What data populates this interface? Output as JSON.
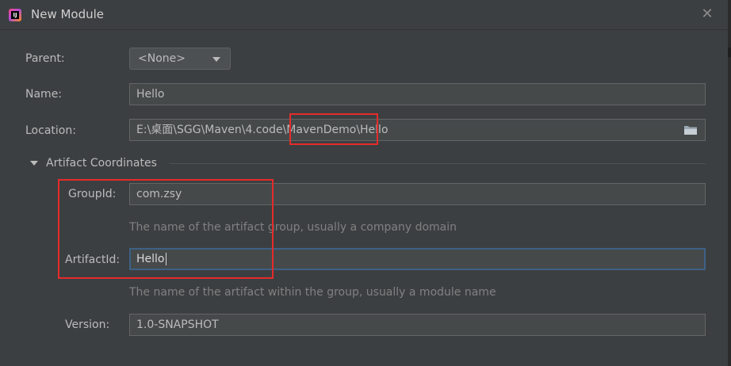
{
  "window": {
    "title": "New Module",
    "close_glyph": "✕",
    "app_icon": "intellij-idea-icon"
  },
  "form": {
    "parent": {
      "label": "Parent:",
      "value": "<None>"
    },
    "name": {
      "label": "Name:",
      "value": "Hello"
    },
    "location": {
      "label": "Location:",
      "value_prefix": "E:\\桌面\\SGG\\Maven\\4.code\\",
      "value_highlight": "MavenDemo",
      "value_suffix": "\\Hello",
      "browse_icon": "folder-icon"
    },
    "artifact_section": {
      "title": "Artifact Coordinates",
      "group_id": {
        "label": "GroupId:",
        "value": "com.zsy",
        "hint": "The name of the artifact group, usually a company domain"
      },
      "artifact_id": {
        "label": "ArtifactId:",
        "value": "Hello",
        "hint": "The name of the artifact within the group, usually a module name"
      },
      "version": {
        "label": "Version:",
        "value": "1.0-SNAPSHOT"
      }
    }
  },
  "colors": {
    "annotation_red": "#e52b2b",
    "focus_blue": "#3d6185",
    "background": "#3c3f41"
  }
}
